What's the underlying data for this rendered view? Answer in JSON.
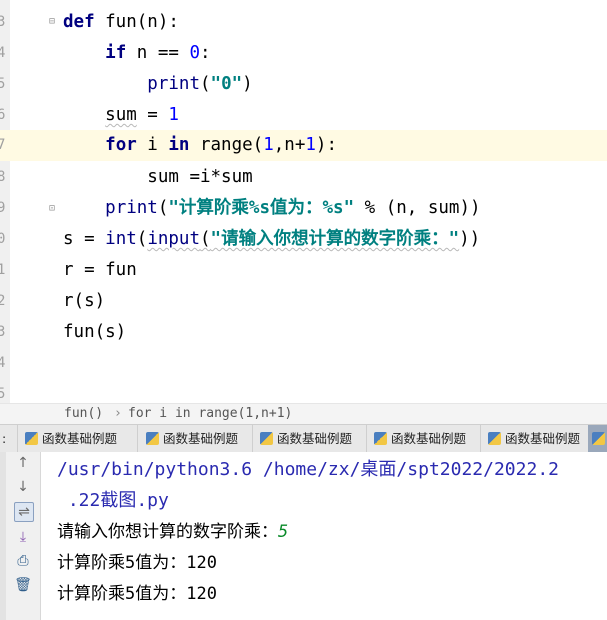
{
  "editor": {
    "lines": [
      {
        "num": "3"
      },
      {
        "num": "4"
      },
      {
        "num": "5"
      },
      {
        "num": "6"
      },
      {
        "num": "7"
      },
      {
        "num": "8"
      },
      {
        "num": "9"
      },
      {
        "num": "0"
      },
      {
        "num": "1"
      },
      {
        "num": "2"
      },
      {
        "num": "3"
      },
      {
        "num": "4"
      },
      {
        "num": "5"
      }
    ],
    "code": {
      "l1_kw": "def",
      "l1_rest": " fun(n):",
      "l2_kw": "if",
      "l2_mid": " n == ",
      "l2_num": "0",
      "l2_end": ":",
      "l3_fn": "print",
      "l3_open": "(",
      "l3_str": "\"0\"",
      "l3_close": ")",
      "l4_var": "sum",
      "l4_mid": " = ",
      "l4_num": "1",
      "l5_kw1": "for",
      "l5_mid1": " i ",
      "l5_kw2": "in",
      "l5_mid2": " range(",
      "l5_num1": "1",
      "l5_mid3": ",n+",
      "l5_num2": "1",
      "l5_end": "):",
      "l6": "sum =i*sum",
      "l7_fn": "print",
      "l7_open": "(",
      "l7_str": "\"计算阶乘%s值为：%s\"",
      "l7_rest": " % (n, sum))",
      "l8_a": "s = ",
      "l8_int": "int",
      "l8_b": "(",
      "l8_input": "input",
      "l8_c": "(",
      "l8_str": "\"请输入你想计算的数字阶乘：\"",
      "l8_d": "))",
      "l9": "r = fun",
      "l10": "r(s)",
      "l11": "fun(s)"
    }
  },
  "breadcrumb": {
    "item1": "fun()",
    "sep": "›",
    "item2": "for i in range(1,n+1)"
  },
  "tabs": [
    {
      "label": "函数基础例题"
    },
    {
      "label": "函数基础例题"
    },
    {
      "label": "函数基础例题"
    },
    {
      "label": "函数基础例题"
    },
    {
      "label": "函数基础例题"
    }
  ],
  "console": {
    "path_line1": "/usr/bin/python3.6 /home/zx/桌面/spt2022/2022.2",
    "path_line2": " .22截图.py",
    "prompt": "请输入你想计算的数字阶乘：",
    "user_input": "5",
    "out1": "计算阶乘5值为：120",
    "out2": "计算阶乘5值为：120"
  },
  "toolbar": {
    "icons": [
      "arrow-up-icon",
      "arrow-down-icon",
      "soft-wrap-icon",
      "scroll-to-end-icon",
      "print-icon",
      "trash-icon"
    ]
  }
}
